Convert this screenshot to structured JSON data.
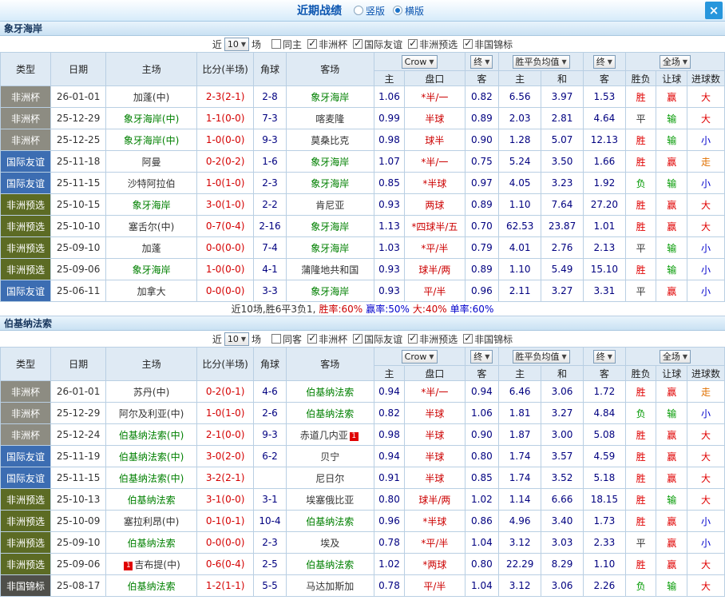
{
  "titlebar": {
    "title": "近期战绩",
    "radios": [
      {
        "label": "竖版",
        "selected": false
      },
      {
        "label": "横版",
        "selected": true
      }
    ],
    "close_label": "×"
  },
  "table_header": {
    "type": "类型",
    "date": "日期",
    "home": "主场",
    "score": "比分(半场)",
    "corner": "角球",
    "away": "客场",
    "crow_select": "Crow",
    "final_select": "终",
    "wdl_select": "胜平负均值",
    "final_select2": "终",
    "scope_select": "全场",
    "sub_odds_home": "主",
    "sub_handicap": "盘口",
    "sub_odds_away": "客",
    "sub_eu_home": "主",
    "sub_eu_draw": "和",
    "sub_eu_away": "客",
    "sub_result": "胜负",
    "sub_handicap_result": "让球",
    "sub_goals": "进球数"
  },
  "colors": {
    "accent_blue": "#1a73c9",
    "focal_team_green": "#008000",
    "score_red": "#d40000",
    "odds_navy": "#000080",
    "type_cup": "#8d8c82",
    "type_friendly": "#3c6db2",
    "type_qual": "#5c6b24",
    "type_champ": "#4f4f4a"
  },
  "sections": [
    {
      "team": "象牙海岸",
      "filter": {
        "near": "近",
        "count": "10",
        "games": "场",
        "same": {
          "label": "同主",
          "checked": false
        },
        "comps": [
          {
            "label": "非洲杯",
            "checked": true
          },
          {
            "label": "国际友谊",
            "checked": true
          },
          {
            "label": "非洲预选",
            "checked": true
          },
          {
            "label": "非国锦标",
            "checked": true
          }
        ]
      },
      "rows": [
        {
          "type": "非洲杯",
          "type_key": "cup",
          "date": "26-01-01",
          "home": "加蓬(中)",
          "home_focal": false,
          "home_badge": "",
          "score": "2-3(2-1)",
          "corner": "2-8",
          "away": "象牙海岸",
          "away_focal": true,
          "away_badge": "",
          "odds": [
            "1.06",
            "*半/一",
            "0.82"
          ],
          "eu": [
            "6.56",
            "3.97",
            "1.53"
          ],
          "results": [
            "胜",
            "赢",
            "大"
          ]
        },
        {
          "type": "非洲杯",
          "type_key": "cup",
          "date": "25-12-29",
          "home": "象牙海岸(中)",
          "home_focal": true,
          "home_badge": "",
          "score": "1-1(0-0)",
          "corner": "7-3",
          "away": "喀麦隆",
          "away_focal": false,
          "away_badge": "",
          "odds": [
            "0.99",
            "半球",
            "0.89"
          ],
          "eu": [
            "2.03",
            "2.81",
            "4.64"
          ],
          "results": [
            "平",
            "输",
            "大"
          ]
        },
        {
          "type": "非洲杯",
          "type_key": "cup",
          "date": "25-12-25",
          "home": "象牙海岸(中)",
          "home_focal": true,
          "home_badge": "",
          "score": "1-0(0-0)",
          "corner": "9-3",
          "away": "莫桑比克",
          "away_focal": false,
          "away_badge": "",
          "odds": [
            "0.98",
            "球半",
            "0.90"
          ],
          "eu": [
            "1.28",
            "5.07",
            "12.13"
          ],
          "results": [
            "胜",
            "输",
            "小"
          ]
        },
        {
          "type": "国际友谊",
          "type_key": "friendly",
          "date": "25-11-18",
          "home": "阿曼",
          "home_focal": false,
          "home_badge": "",
          "score": "0-2(0-2)",
          "corner": "1-6",
          "away": "象牙海岸",
          "away_focal": true,
          "away_badge": "",
          "odds": [
            "1.07",
            "*半/一",
            "0.75"
          ],
          "eu": [
            "5.24",
            "3.50",
            "1.66"
          ],
          "results": [
            "胜",
            "赢",
            "走"
          ]
        },
        {
          "type": "国际友谊",
          "type_key": "friendly",
          "date": "25-11-15",
          "home": "沙特阿拉伯",
          "home_focal": false,
          "home_badge": "",
          "score": "1-0(1-0)",
          "corner": "2-3",
          "away": "象牙海岸",
          "away_focal": true,
          "away_badge": "",
          "odds": [
            "0.85",
            "*半球",
            "0.97"
          ],
          "eu": [
            "4.05",
            "3.23",
            "1.92"
          ],
          "results": [
            "负",
            "输",
            "小"
          ]
        },
        {
          "type": "非洲预选",
          "type_key": "qual",
          "date": "25-10-15",
          "home": "象牙海岸",
          "home_focal": true,
          "home_badge": "",
          "score": "3-0(1-0)",
          "corner": "2-2",
          "away": "肯尼亚",
          "away_focal": false,
          "away_badge": "",
          "odds": [
            "0.93",
            "两球",
            "0.89"
          ],
          "eu": [
            "1.10",
            "7.64",
            "27.20"
          ],
          "results": [
            "胜",
            "赢",
            "大"
          ]
        },
        {
          "type": "非洲预选",
          "type_key": "qual",
          "date": "25-10-10",
          "home": "塞舌尔(中)",
          "home_focal": false,
          "home_badge": "",
          "score": "0-7(0-4)",
          "corner": "2-16",
          "away": "象牙海岸",
          "away_focal": true,
          "away_badge": "",
          "odds": [
            "1.13",
            "*四球半/五",
            "0.70"
          ],
          "eu": [
            "62.53",
            "23.87",
            "1.01"
          ],
          "results": [
            "胜",
            "赢",
            "大"
          ]
        },
        {
          "type": "非洲预选",
          "type_key": "qual",
          "date": "25-09-10",
          "home": "加蓬",
          "home_focal": false,
          "home_badge": "",
          "score": "0-0(0-0)",
          "corner": "7-4",
          "away": "象牙海岸",
          "away_focal": true,
          "away_badge": "",
          "odds": [
            "1.03",
            "*平/半",
            "0.79"
          ],
          "eu": [
            "4.01",
            "2.76",
            "2.13"
          ],
          "results": [
            "平",
            "输",
            "小"
          ]
        },
        {
          "type": "非洲预选",
          "type_key": "qual",
          "date": "25-09-06",
          "home": "象牙海岸",
          "home_focal": true,
          "home_badge": "",
          "score": "1-0(0-0)",
          "corner": "4-1",
          "away": "蒲隆地共和国",
          "away_focal": false,
          "away_badge": "",
          "odds": [
            "0.93",
            "球半/两",
            "0.89"
          ],
          "eu": [
            "1.10",
            "5.49",
            "15.10"
          ],
          "results": [
            "胜",
            "输",
            "小"
          ]
        },
        {
          "type": "国际友谊",
          "type_key": "friendly",
          "date": "25-06-11",
          "home": "加拿大",
          "home_focal": false,
          "home_badge": "",
          "score": "0-0(0-0)",
          "corner": "3-3",
          "away": "象牙海岸",
          "away_focal": true,
          "away_badge": "",
          "odds": [
            "0.93",
            "平/半",
            "0.96"
          ],
          "eu": [
            "2.11",
            "3.27",
            "3.31"
          ],
          "results": [
            "平",
            "赢",
            "小"
          ]
        }
      ],
      "summary": [
        {
          "text": "近10场,胜6平3负1, ",
          "color": "dark"
        },
        {
          "text": "胜率:60% ",
          "color": "red"
        },
        {
          "text": "赢率:50% ",
          "color": "blue"
        },
        {
          "text": "大:40% ",
          "color": "red"
        },
        {
          "text": "单率:60%",
          "color": "blue"
        }
      ]
    },
    {
      "team": "伯基纳法索",
      "filter": {
        "near": "近",
        "count": "10",
        "games": "场",
        "same": {
          "label": "同客",
          "checked": false
        },
        "comps": [
          {
            "label": "非洲杯",
            "checked": true
          },
          {
            "label": "国际友谊",
            "checked": true
          },
          {
            "label": "非洲预选",
            "checked": true
          },
          {
            "label": "非国锦标",
            "checked": true
          }
        ]
      },
      "rows": [
        {
          "type": "非洲杯",
          "type_key": "cup",
          "date": "26-01-01",
          "home": "苏丹(中)",
          "home_focal": false,
          "home_badge": "",
          "score": "0-2(0-1)",
          "corner": "4-6",
          "away": "伯基纳法索",
          "away_focal": true,
          "away_badge": "",
          "odds": [
            "0.94",
            "*半/一",
            "0.94"
          ],
          "eu": [
            "6.46",
            "3.06",
            "1.72"
          ],
          "results": [
            "胜",
            "赢",
            "走"
          ]
        },
        {
          "type": "非洲杯",
          "type_key": "cup",
          "date": "25-12-29",
          "home": "阿尔及利亚(中)",
          "home_focal": false,
          "home_badge": "",
          "score": "1-0(1-0)",
          "corner": "2-6",
          "away": "伯基纳法索",
          "away_focal": true,
          "away_badge": "",
          "odds": [
            "0.82",
            "半球",
            "1.06"
          ],
          "eu": [
            "1.81",
            "3.27",
            "4.84"
          ],
          "results": [
            "负",
            "输",
            "小"
          ]
        },
        {
          "type": "非洲杯",
          "type_key": "cup",
          "date": "25-12-24",
          "home": "伯基纳法索(中)",
          "home_focal": true,
          "home_badge": "",
          "score": "2-1(0-0)",
          "corner": "9-3",
          "away": "赤道几内亚",
          "away_focal": false,
          "away_badge": "1",
          "odds": [
            "0.98",
            "半球",
            "0.90"
          ],
          "eu": [
            "1.87",
            "3.00",
            "5.08"
          ],
          "results": [
            "胜",
            "赢",
            "大"
          ]
        },
        {
          "type": "国际友谊",
          "type_key": "friendly",
          "date": "25-11-19",
          "home": "伯基纳法索(中)",
          "home_focal": true,
          "home_badge": "",
          "score": "3-0(2-0)",
          "corner": "6-2",
          "away": "贝宁",
          "away_focal": false,
          "away_badge": "",
          "odds": [
            "0.94",
            "半球",
            "0.80"
          ],
          "eu": [
            "1.74",
            "3.57",
            "4.59"
          ],
          "results": [
            "胜",
            "赢",
            "大"
          ]
        },
        {
          "type": "国际友谊",
          "type_key": "friendly",
          "date": "25-11-15",
          "home": "伯基纳法索(中)",
          "home_focal": true,
          "home_badge": "",
          "score": "3-2(2-1)",
          "corner": "",
          "away": "尼日尔",
          "away_focal": false,
          "away_badge": "",
          "odds": [
            "0.91",
            "半球",
            "0.85"
          ],
          "eu": [
            "1.74",
            "3.52",
            "5.18"
          ],
          "results": [
            "胜",
            "赢",
            "大"
          ]
        },
        {
          "type": "非洲预选",
          "type_key": "qual",
          "date": "25-10-13",
          "home": "伯基纳法索",
          "home_focal": true,
          "home_badge": "",
          "score": "3-1(0-0)",
          "corner": "3-1",
          "away": "埃塞俄比亚",
          "away_focal": false,
          "away_badge": "",
          "odds": [
            "0.80",
            "球半/两",
            "1.02"
          ],
          "eu": [
            "1.14",
            "6.66",
            "18.15"
          ],
          "results": [
            "胜",
            "输",
            "大"
          ]
        },
        {
          "type": "非洲预选",
          "type_key": "qual",
          "date": "25-10-09",
          "home": "塞拉利昂(中)",
          "home_focal": false,
          "home_badge": "",
          "score": "0-1(0-1)",
          "corner": "10-4",
          "away": "伯基纳法索",
          "away_focal": true,
          "away_badge": "",
          "odds": [
            "0.96",
            "*半球",
            "0.86"
          ],
          "eu": [
            "4.96",
            "3.40",
            "1.73"
          ],
          "results": [
            "胜",
            "赢",
            "小"
          ]
        },
        {
          "type": "非洲预选",
          "type_key": "qual",
          "date": "25-09-10",
          "home": "伯基纳法索",
          "home_focal": true,
          "home_badge": "",
          "score": "0-0(0-0)",
          "corner": "2-3",
          "away": "埃及",
          "away_focal": false,
          "away_badge": "",
          "odds": [
            "0.78",
            "*平/半",
            "1.04"
          ],
          "eu": [
            "3.12",
            "3.03",
            "2.33"
          ],
          "results": [
            "平",
            "赢",
            "小"
          ]
        },
        {
          "type": "非洲预选",
          "type_key": "qual",
          "date": "25-09-06",
          "home": "吉布提(中)",
          "home_focal": false,
          "home_badge": "1",
          "score": "0-6(0-4)",
          "corner": "2-5",
          "away": "伯基纳法索",
          "away_focal": true,
          "away_badge": "",
          "odds": [
            "1.02",
            "*两球",
            "0.80"
          ],
          "eu": [
            "22.29",
            "8.29",
            "1.10"
          ],
          "results": [
            "胜",
            "赢",
            "大"
          ]
        },
        {
          "type": "非国锦标",
          "type_key": "champ",
          "date": "25-08-17",
          "home": "伯基纳法索",
          "home_focal": true,
          "home_badge": "",
          "score": "1-2(1-1)",
          "corner": "5-5",
          "away": "马达加斯加",
          "away_focal": false,
          "away_badge": "",
          "odds": [
            "0.78",
            "平/半",
            "1.04"
          ],
          "eu": [
            "3.12",
            "3.06",
            "2.26"
          ],
          "results": [
            "负",
            "输",
            "大"
          ]
        }
      ]
    }
  ]
}
